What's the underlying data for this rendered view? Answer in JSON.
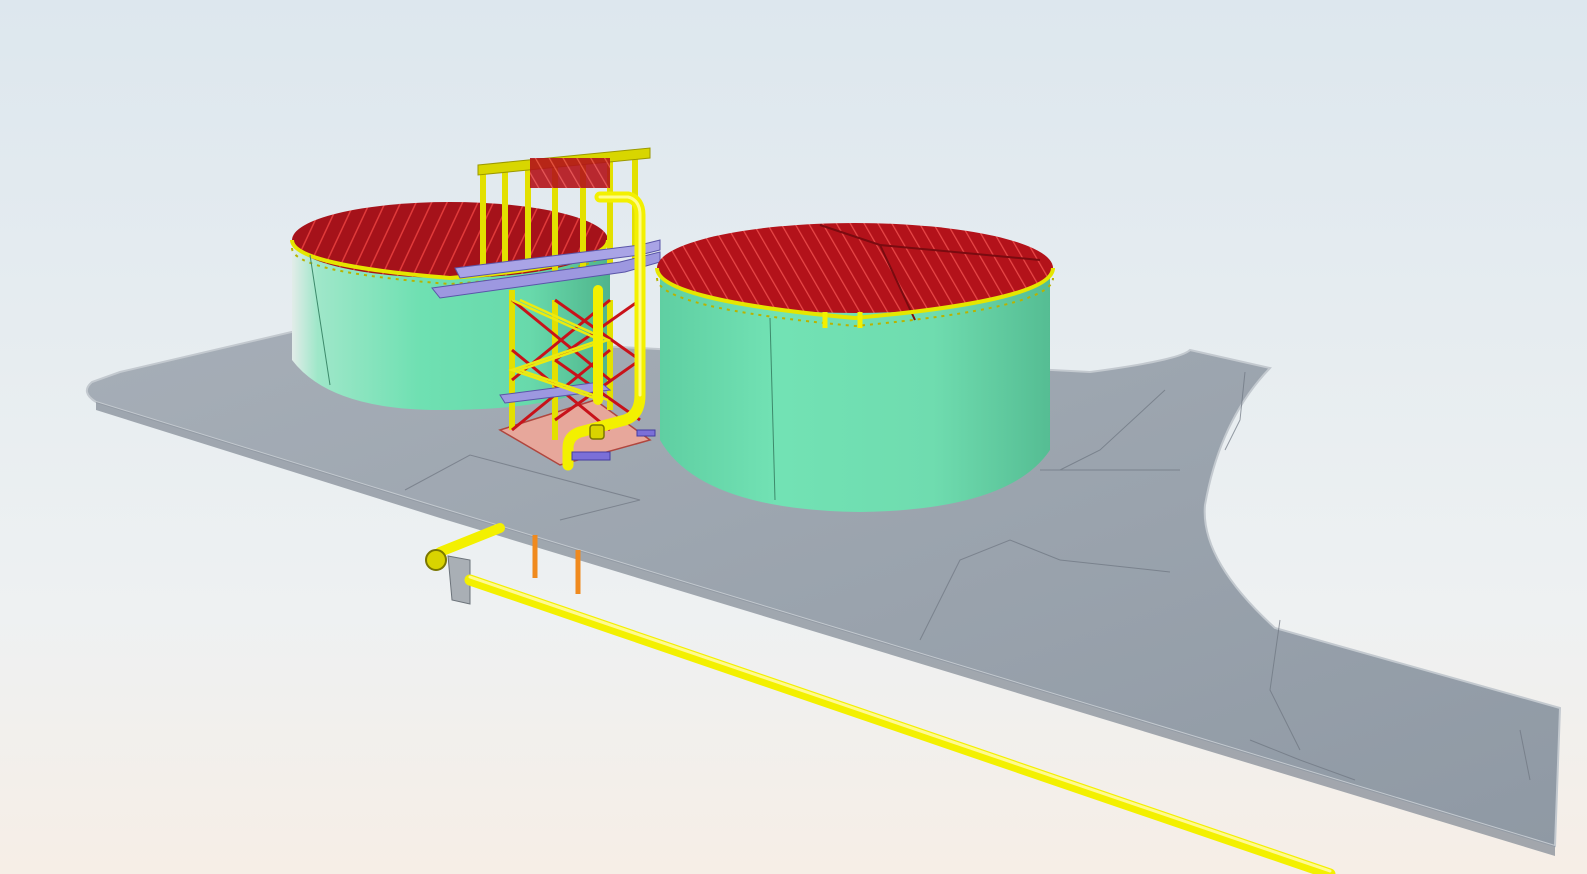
{
  "viewer": {
    "scene": "3d-model-viewport",
    "colors": {
      "sky_top": "#dfe8ee",
      "sky_bottom": "#f4eee6",
      "ground_slab": "#9aa3ad",
      "ground_edge": "#b6bec6",
      "tank_shell": "#6fe0b2",
      "tank_shadow": "#4fb48c",
      "roof_frame": "#b3121a",
      "steel_structure": "#c8121a",
      "pipe": "#f3f000",
      "pipe_support": "#f08a1e",
      "platform": "#8e8ad8",
      "valve_block": "#a9afb5"
    }
  }
}
